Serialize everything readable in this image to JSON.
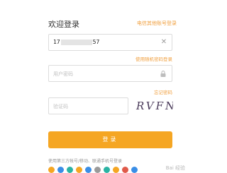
{
  "header": {
    "title": "欢迎登录",
    "switch_link": "电信其他账号登录"
  },
  "phone": {
    "prefix": "17",
    "suffix": "57",
    "clear_icon": "close-icon"
  },
  "links": {
    "random_password": "使用随机密码登录",
    "forgot_password": "忘记密码"
  },
  "password": {
    "placeholder": "用户密码",
    "icon": "lock-icon"
  },
  "captcha": {
    "placeholder": "验证码",
    "code": "RVFN"
  },
  "login_button": {
    "label": "登录"
  },
  "third_party": {
    "text": "使用第三方帐号/移动、联通手机号登录",
    "icons": [
      "orange",
      "blue",
      "teal",
      "orange",
      "blue",
      "gray",
      "teal",
      "orange",
      "red",
      "blue"
    ]
  },
  "watermark": {
    "text": "Bai 经验"
  },
  "colors": {
    "accent": "#f5a623",
    "link": "#f0a040"
  }
}
